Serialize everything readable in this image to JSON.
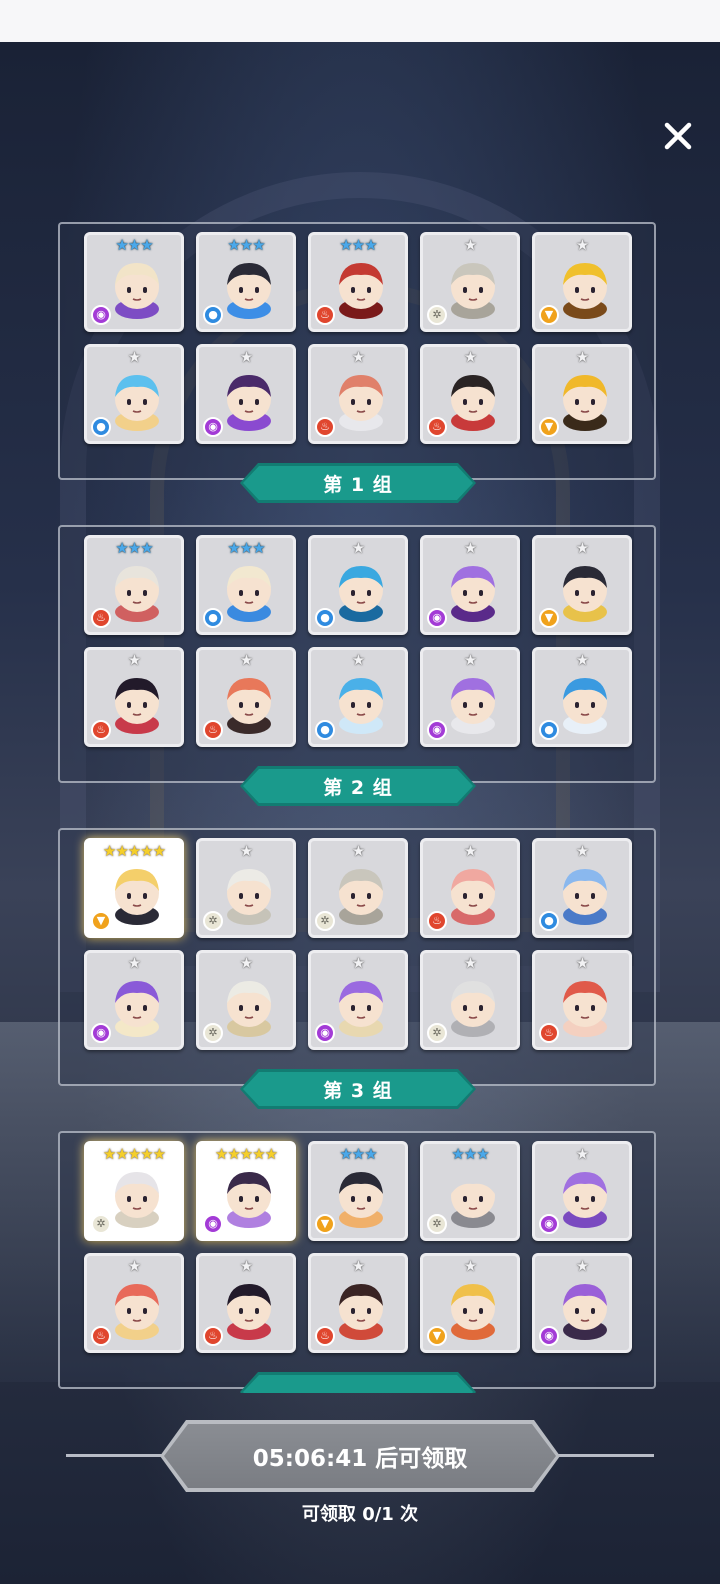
{
  "groups": [
    {
      "label": "第 1 组",
      "heroes": [
        {
          "stars": 3,
          "element": "dark",
          "avatar": "white-hair-masked-ninja",
          "hair": "#f2e4c8",
          "accent": "#7d4cc4"
        },
        {
          "stars": 3,
          "element": "water",
          "avatar": "blue-mask-samurai",
          "hair": "#2a2a36",
          "accent": "#3d8ee6"
        },
        {
          "stars": 3,
          "element": "fire",
          "avatar": "red-spellbook-eye",
          "hair": "#c43a32",
          "accent": "#7a1a1a"
        },
        {
          "stars": 1,
          "element": "light",
          "avatar": "gray-cactus",
          "hair": "#c9c6bc",
          "accent": "#a8a49a"
        },
        {
          "stars": 1,
          "element": "wind",
          "avatar": "yellow-sunflower-beast",
          "hair": "#f0c02c",
          "accent": "#7a4a1a"
        },
        {
          "stars": 1,
          "element": "water",
          "avatar": "blue-wolf",
          "hair": "#5cc0ee",
          "accent": "#f2d08a"
        },
        {
          "stars": 1,
          "element": "dark",
          "avatar": "purple-witch-girl",
          "hair": "#4a2a6a",
          "accent": "#8a4ad0"
        },
        {
          "stars": 1,
          "element": "fire",
          "avatar": "winged-helmet-knight",
          "hair": "#e0806a",
          "accent": "#e8e8ec"
        },
        {
          "stars": 1,
          "element": "fire",
          "avatar": "red-hat-card-soldier",
          "hair": "#2a2424",
          "accent": "#c83a3a"
        },
        {
          "stars": 1,
          "element": "wind",
          "avatar": "golden-treasure-chest",
          "hair": "#f0b82a",
          "accent": "#3a2a1a"
        }
      ]
    },
    {
      "label": "第 2 组",
      "heroes": [
        {
          "stars": 3,
          "element": "fire",
          "avatar": "bandaged-horned-mummy",
          "hair": "#e8e4dc",
          "accent": "#d06060"
        },
        {
          "stars": 3,
          "element": "water",
          "avatar": "white-hair-blue-masked-ninja",
          "hair": "#f2e8d0",
          "accent": "#3a8ae0"
        },
        {
          "stars": 1,
          "element": "water",
          "avatar": "blue-fuzzball",
          "hair": "#3aa8e0",
          "accent": "#1a6aa0"
        },
        {
          "stars": 1,
          "element": "dark",
          "avatar": "purple-skull-ghost",
          "hair": "#a070e0",
          "accent": "#5a2a8a"
        },
        {
          "stars": 1,
          "element": "wind",
          "avatar": "gold-helmet-warrior",
          "hair": "#2a2a36",
          "accent": "#e8c24a"
        },
        {
          "stars": 1,
          "element": "fire",
          "avatar": "black-hair-shrine-maiden",
          "hair": "#221a2a",
          "accent": "#c83a4a"
        },
        {
          "stars": 1,
          "element": "fire",
          "avatar": "orange-rock-golem",
          "hair": "#e8785a",
          "accent": "#3a2a2a"
        },
        {
          "stars": 1,
          "element": "water",
          "avatar": "blue-hair-diamond-girl",
          "hair": "#4ab0e8",
          "accent": "#cfe8f8"
        },
        {
          "stars": 1,
          "element": "dark",
          "avatar": "purple-winged-helmet-knight",
          "hair": "#a070e0",
          "accent": "#e8e8ec"
        },
        {
          "stars": 1,
          "element": "water",
          "avatar": "blue-unicorn-dragon",
          "hair": "#3a9ae0",
          "accent": "#e8f0f8"
        }
      ]
    },
    {
      "label": "第 3 组",
      "heroes": [
        {
          "stars": 5,
          "element": "wind",
          "avatar": "blonde-maid-girl",
          "hair": "#f4cf6a",
          "accent": "#2a2a36"
        },
        {
          "stars": 1,
          "element": "light",
          "avatar": "white-mummy",
          "hair": "#ecebe6",
          "accent": "#c6c3b8"
        },
        {
          "stars": 1,
          "element": "light",
          "avatar": "gray-cactus",
          "hair": "#c9c6bc",
          "accent": "#a8a49a"
        },
        {
          "stars": 1,
          "element": "fire",
          "avatar": "pink-slime-ghost",
          "hair": "#f0a8a0",
          "accent": "#d86a6a"
        },
        {
          "stars": 1,
          "element": "water",
          "avatar": "blue-slime-ghost",
          "hair": "#8ab8ee",
          "accent": "#4a7ac8"
        },
        {
          "stars": 1,
          "element": "dark",
          "avatar": "purple-wizard-cat",
          "hair": "#8a5ad8",
          "accent": "#f4e8c8"
        },
        {
          "stars": 1,
          "element": "light",
          "avatar": "white-cat-eared-girl",
          "hair": "#ecebe4",
          "accent": "#d8c8a0"
        },
        {
          "stars": 1,
          "element": "dark",
          "avatar": "purple-cat-eared-girl",
          "hair": "#9a6ae0",
          "accent": "#e8d8b0"
        },
        {
          "stars": 1,
          "element": "light",
          "avatar": "silver-antenna-girl",
          "hair": "#e0e0e0",
          "accent": "#b0b0b4"
        },
        {
          "stars": 1,
          "element": "fire",
          "avatar": "red-flame-ring-spirit",
          "hair": "#e05a4a",
          "accent": "#f4d0c0"
        }
      ]
    },
    {
      "label": "",
      "heroes": [
        {
          "stars": 5,
          "element": "light",
          "avatar": "silver-hair-goddess",
          "hair": "#e6e4e8",
          "accent": "#d8d0c0"
        },
        {
          "stars": 5,
          "element": "dark",
          "avatar": "purple-gem-sorceress",
          "hair": "#3a2a4a",
          "accent": "#b080e0"
        },
        {
          "stars": 3,
          "element": "wind",
          "avatar": "bandaged-scout",
          "hair": "#2a2a36",
          "accent": "#f0b06a"
        },
        {
          "stars": 3,
          "element": "light",
          "avatar": "armored-white-robot",
          "hair": "#d8d8dc",
          "accent": "#8a8a90"
        },
        {
          "stars": 1,
          "element": "dark",
          "avatar": "purple-cactus",
          "hair": "#a070e0",
          "accent": "#7a4ac0"
        },
        {
          "stars": 1,
          "element": "fire",
          "avatar": "red-wolf",
          "hair": "#e86a5a",
          "accent": "#f2d08a"
        },
        {
          "stars": 1,
          "element": "fire",
          "avatar": "black-hair-shrine-maiden",
          "hair": "#221a2a",
          "accent": "#c83a4a"
        },
        {
          "stars": 1,
          "element": "fire",
          "avatar": "red-witch-girl",
          "hair": "#3a2424",
          "accent": "#d04a3a"
        },
        {
          "stars": 1,
          "element": "wind",
          "avatar": "golden-flame-ring-spirit",
          "hair": "#f0c04a",
          "accent": "#e06a3a"
        },
        {
          "stars": 1,
          "element": "dark",
          "avatar": "purple-treasure-chest",
          "hair": "#9a60d8",
          "accent": "#3a2a4a"
        }
      ]
    }
  ],
  "claim": {
    "countdown_label": "05:06:41 后可领取",
    "count_label": "可领取 0/1 次"
  },
  "close_icon": "close-icon",
  "colors": {
    "group_label": "#1a9a8c",
    "claim_button_disabled": "#7a7d83",
    "star_blue": "#4aa8ea",
    "star_gold": "#f5cf2b"
  }
}
